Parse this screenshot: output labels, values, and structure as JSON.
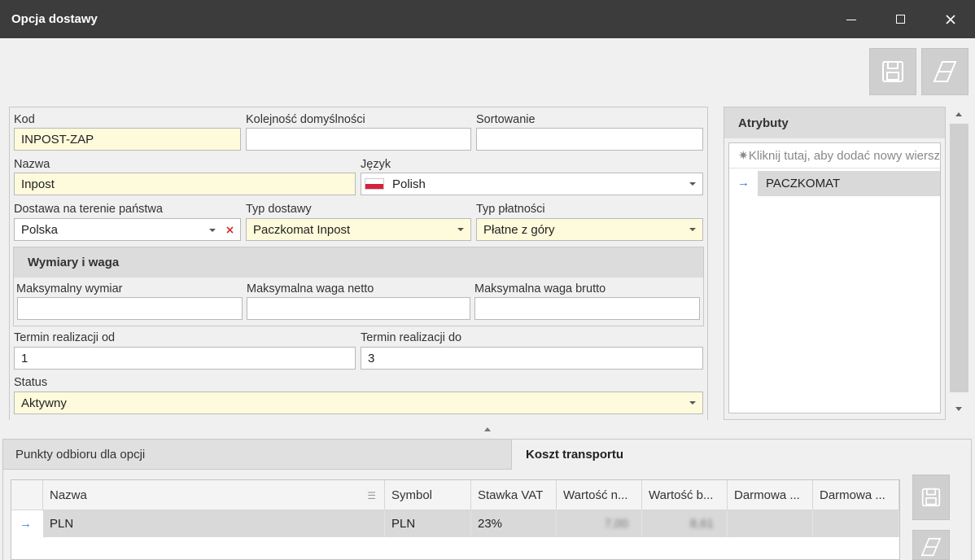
{
  "window": {
    "title": "Opcja dostawy"
  },
  "form": {
    "kod": {
      "label": "Kod",
      "value": "INPOST-ZAP"
    },
    "kolejnosc": {
      "label": "Kolejność domyślności",
      "value": ""
    },
    "sortowanie": {
      "label": "Sortowanie",
      "value": ""
    },
    "nazwa": {
      "label": "Nazwa",
      "value": "Inpost"
    },
    "jezyk": {
      "label": "Język",
      "value": "Polish"
    },
    "dostawa_panstwo": {
      "label": "Dostawa na terenie państwa",
      "value": "Polska"
    },
    "typ_dostawy": {
      "label": "Typ dostawy",
      "value": "Paczkomat Inpost"
    },
    "typ_platnosci": {
      "label": "Typ płatności",
      "value": "Płatne z góry"
    },
    "wymiary_group": {
      "title": "Wymiary i waga",
      "max_wymiar": {
        "label": "Maksymalny wymiar",
        "value": ""
      },
      "max_netto": {
        "label": "Maksymalna waga netto",
        "value": ""
      },
      "max_brutto": {
        "label": "Maksymalna waga brutto",
        "value": ""
      }
    },
    "termin_od": {
      "label": "Termin realizacji od",
      "value": "1"
    },
    "termin_do": {
      "label": "Termin realizacji do",
      "value": "3"
    },
    "status": {
      "label": "Status",
      "value": "Aktywny"
    }
  },
  "atrybuty": {
    "title": "Atrybuty",
    "new_row_placeholder": "Kliknij tutaj, aby dodać nowy wiersz",
    "rows": [
      "PACZKOMAT"
    ]
  },
  "tabs": [
    {
      "label": "Punkty odbioru dla opcji",
      "active": false
    },
    {
      "label": "Koszt transportu",
      "active": true
    }
  ],
  "grid": {
    "columns": [
      "Nazwa",
      "Symbol",
      "Stawka VAT",
      "Wartość n...",
      "Wartość b...",
      "Darmowa ...",
      "Darmowa ..."
    ],
    "rows": [
      {
        "nazwa": "PLN",
        "symbol": "PLN",
        "stawka_vat": "23%",
        "wartosc_netto": "7,00",
        "wartosc_brutto": "8,61",
        "darmowa_1": "",
        "darmowa_2": ""
      }
    ]
  },
  "colors": {
    "titlebar": "#3c3c3c",
    "required_field": "#fdfbdb",
    "group_header": "#dcdcdc",
    "selected_row": "#d9d9d9",
    "arrow_blue": "#2f7fd8",
    "clear_red": "#d03030"
  },
  "icons": {
    "save": "save-icon",
    "eraser": "eraser-icon",
    "row_indicator": "arrow-right-icon",
    "new_row": "asterisk-icon",
    "collapse": "chevron-up-icon",
    "flag": "flag-poland-icon"
  }
}
